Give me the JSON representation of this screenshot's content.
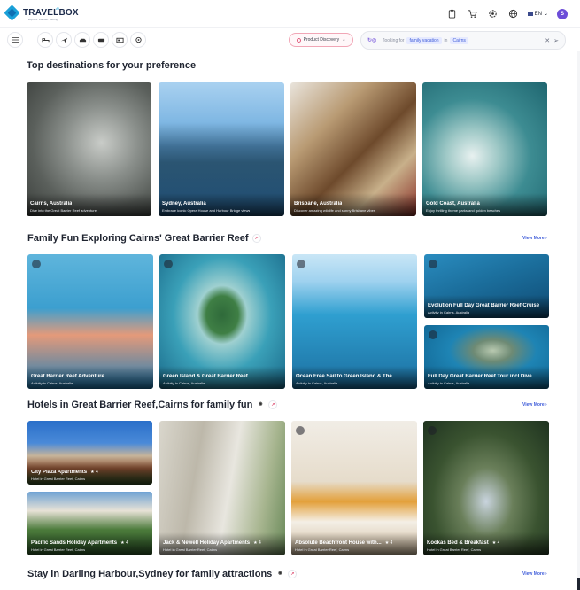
{
  "brand": {
    "name": "TRAVELBOX",
    "tagline": "Explore. Wander. Belong.",
    "beta": "AI"
  },
  "header": {
    "lang": "EN",
    "avatar": "S"
  },
  "nav": {
    "product_discovery": "Product Discovery",
    "search": {
      "prefix": "/looking for",
      "chip1": "family vacation",
      "mid": "in",
      "chip2": "Cairns"
    }
  },
  "sections": {
    "top": {
      "title": "Top destinations for your preference"
    },
    "family": {
      "title": "Family Fun Exploring Cairns' Great Barrier Reef",
      "view_more": "View More"
    },
    "hotels": {
      "title": "Hotels in Great Barrier Reef,Cairns for family fun",
      "view_more": "View More"
    },
    "darling": {
      "title": "Stay in Darling Harbour,Sydney for family attractions",
      "view_more": "View More"
    }
  },
  "destinations": [
    {
      "title": "Cairns, Australia",
      "sub": "Dive into the Great Barrier Reef adventure!"
    },
    {
      "title": "Sydney, Australia",
      "sub": "Embrace iconic Opera House and Harbour Bridge views"
    },
    {
      "title": "Brisbane, Australia",
      "sub": "Discover amazing wildlife and sunny Brisbane vibes"
    },
    {
      "title": "Gold Coast, Australia",
      "sub": "Enjoy thrilling theme parks and golden beaches"
    }
  ],
  "activities": [
    {
      "title": "Great Barrier Reef Adventure",
      "sub": "Activity in Cairns, Australia"
    },
    {
      "title": "Green Island & Great Barrier Reef...",
      "sub": "Activity in Cairns, Australia"
    },
    {
      "title": "Ocean Free Sail to Green Island & The...",
      "sub": "Activity in Cairns, Australia"
    },
    {
      "title": "Evolution Full Day Great Barrier Reef Cruise",
      "sub": "Activity in Cairns, Australia"
    },
    {
      "title": "Full Day Great Barrier Reef Tour incl Dive",
      "sub": "Activity in Cairns, Australia"
    }
  ],
  "hotels": [
    {
      "title": "City Plaza Apartments",
      "rating": "4",
      "sub": "Hotel in Great Barrier Reef, Cairns"
    },
    {
      "title": "Pacific Sands Holiday Apartments",
      "rating": "4",
      "sub": "Hotel in Great Barrier Reef, Cairns"
    },
    {
      "title": "Jack & Newell Holiday Apartments",
      "rating": "4",
      "sub": "Hotel in Great Barrier Reef, Cairns"
    },
    {
      "title": "Absolute Beachfront House with...",
      "rating": "4",
      "sub": "Hotel in Great Barrier Reef, Cairns"
    },
    {
      "title": "Kookas Bed & Breakfast",
      "rating": "4",
      "sub": "Hotel in Great Barrier Reef, Cairns"
    }
  ]
}
